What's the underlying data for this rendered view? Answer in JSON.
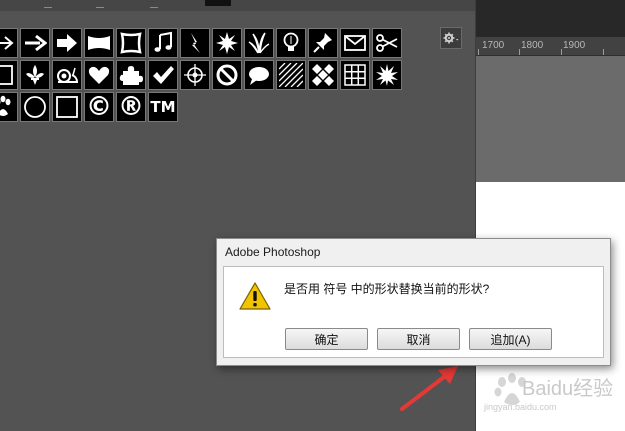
{
  "ruler": {
    "labels": [
      "1700",
      "1800",
      "1900"
    ]
  },
  "shapes": {
    "row1": [
      "arrow-thin",
      "arrow-right",
      "arrow-bold",
      "banner",
      "frame",
      "music-note",
      "lightning",
      "starburst",
      "grass",
      "lightbulb",
      "pin",
      "envelope",
      "scissors"
    ],
    "row2": [
      "square",
      "fleur-de-lis",
      "snail",
      "heart",
      "puzzle",
      "checkmark",
      "crosshair",
      "no-sign",
      "speech-bubble",
      "hatch",
      "diamond-grid",
      "grid",
      "sunburst"
    ],
    "row3": [
      "paw",
      "circle",
      "square-frame",
      "copyright",
      "registered",
      "trademark"
    ],
    "labels": {
      "copyright": "©",
      "registered": "®",
      "trademark": "TM"
    }
  },
  "dialog": {
    "title": "Adobe Photoshop",
    "message": "是否用 符号 中的形状替换当前的形状?",
    "buttons": {
      "ok": "确定",
      "cancel": "取消",
      "append": "追加(A)"
    }
  },
  "watermark": {
    "brand": "Baidu经验",
    "url": "jingyan.baidu.com"
  },
  "colors": {
    "panel": "#535353",
    "arrow": "#e53935",
    "warning": "#f2c400"
  }
}
